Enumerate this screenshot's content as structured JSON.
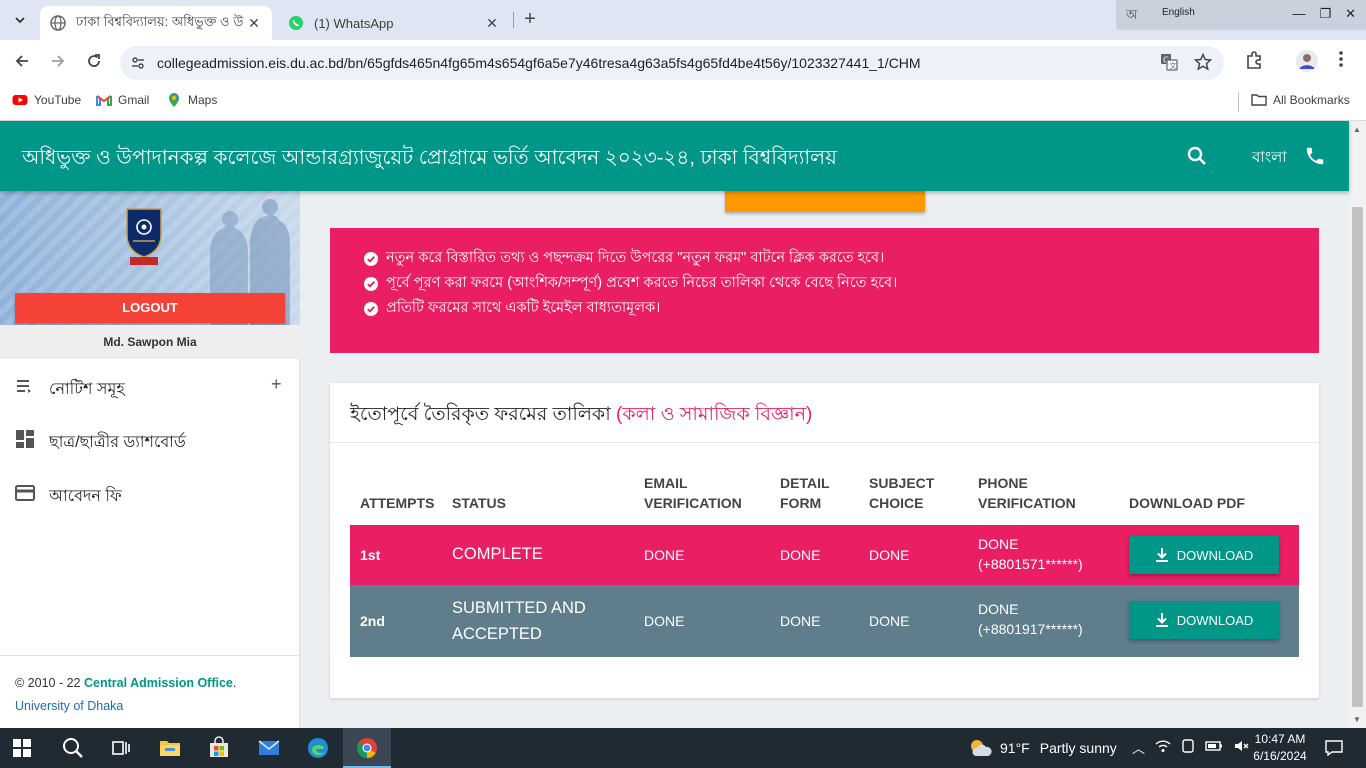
{
  "browser": {
    "tabs": [
      {
        "title": "ঢাকা বিশ্ববিদ্যালয়: অধিভুক্ত ও উ",
        "active": true
      },
      {
        "title": "(1) WhatsApp",
        "active": false
      }
    ],
    "url": "collegeadmission.eis.du.ac.bd/bn/65gfds465n4fg65m4s654gf6a5e7y46tresa4g63a5fs4g65fd4be4t56y/1023327441_1/CHM",
    "bookmarks": [
      "YouTube",
      "Gmail",
      "Maps"
    ],
    "all_bookmarks": "All Bookmarks",
    "ime": {
      "glyph": "অ",
      "language": "English"
    }
  },
  "header": {
    "title": "অধিভুক্ত ও উপাদানকল্প কলেজে আন্ডারগ্র্যাজুয়েট প্রোগ্রামে ভর্তি আবেদন ২০২৩-২৪, ঢাকা বিশ্ববিদ্যালয়",
    "language": "বাংলা"
  },
  "sidebar": {
    "logout": "LOGOUT",
    "username": "Md. Sawpon Mia",
    "menu": [
      {
        "label": "নোটিশ সমূহ",
        "icon": "list-icon",
        "expandable": true
      },
      {
        "label": "ছাত্র/ছাত্রীর ড্যাশবোর্ড",
        "icon": "dashboard-icon",
        "expandable": false
      },
      {
        "label": "আবেদন ফি",
        "icon": "credit-card-icon",
        "expandable": false
      }
    ],
    "footer": {
      "copyright": "© 2010 - 22",
      "office": "Central Admission Office",
      "period": ".",
      "university": "University of Dhaka"
    }
  },
  "alert": {
    "lines": [
      "নতুন করে বিস্তারিত তথ্য ও পছন্দক্রম দিতে উপরের \"নতুন ফরম\" বাটনে ক্লিক করতে হবে।",
      "পূর্বে পূরণ করা ফরমে (আংশিক/সম্পূর্ণ) প্রবেশ করতে নিচের তালিকা থেকে বেছে নিতে হবে।",
      "প্রতিটি ফরমের সাথে একটি ইমেইল বাধ্যতামূলক।"
    ]
  },
  "forms": {
    "title": "ইতোপূর্বে তৈরিকৃত ফরমের তালিকা",
    "title_accent": "(কলা ও সামাজিক বিজ্ঞান)",
    "columns": {
      "attempts": "ATTEMPTS",
      "status": "STATUS",
      "email_1": "EMAIL",
      "email_2": "VERIFICATION",
      "detail_1": "DETAIL",
      "detail_2": "FORM",
      "subject_1": "SUBJECT",
      "subject_2": "CHOICE",
      "phone_1": "PHONE",
      "phone_2": "VERIFICATION",
      "download": "DOWNLOAD PDF"
    },
    "rows": [
      {
        "attempt": "1st",
        "status_1": "COMPLETE",
        "status_2": "",
        "email": "DONE",
        "detail": "DONE",
        "subject": "DONE",
        "phone_1": "DONE",
        "phone_2": "(+8801571******)",
        "download": "DOWNLOAD",
        "color": "#e91e63"
      },
      {
        "attempt": "2nd",
        "status_1": "SUBMITTED AND",
        "status_2": "ACCEPTED",
        "email": "DONE",
        "detail": "DONE",
        "subject": "DONE",
        "phone_1": "DONE",
        "phone_2": "(+8801917******)",
        "download": "DOWNLOAD",
        "color": "#607d8b"
      }
    ]
  },
  "taskbar": {
    "weather": {
      "temp": "91°F",
      "desc": "Partly sunny"
    },
    "time": "10:47 AM",
    "date": "6/16/2024"
  },
  "colors": {
    "primary": "#009688",
    "accent": "#e91e63",
    "logout": "#f44336",
    "orange": "#ff9800",
    "row2": "#607d8b"
  }
}
